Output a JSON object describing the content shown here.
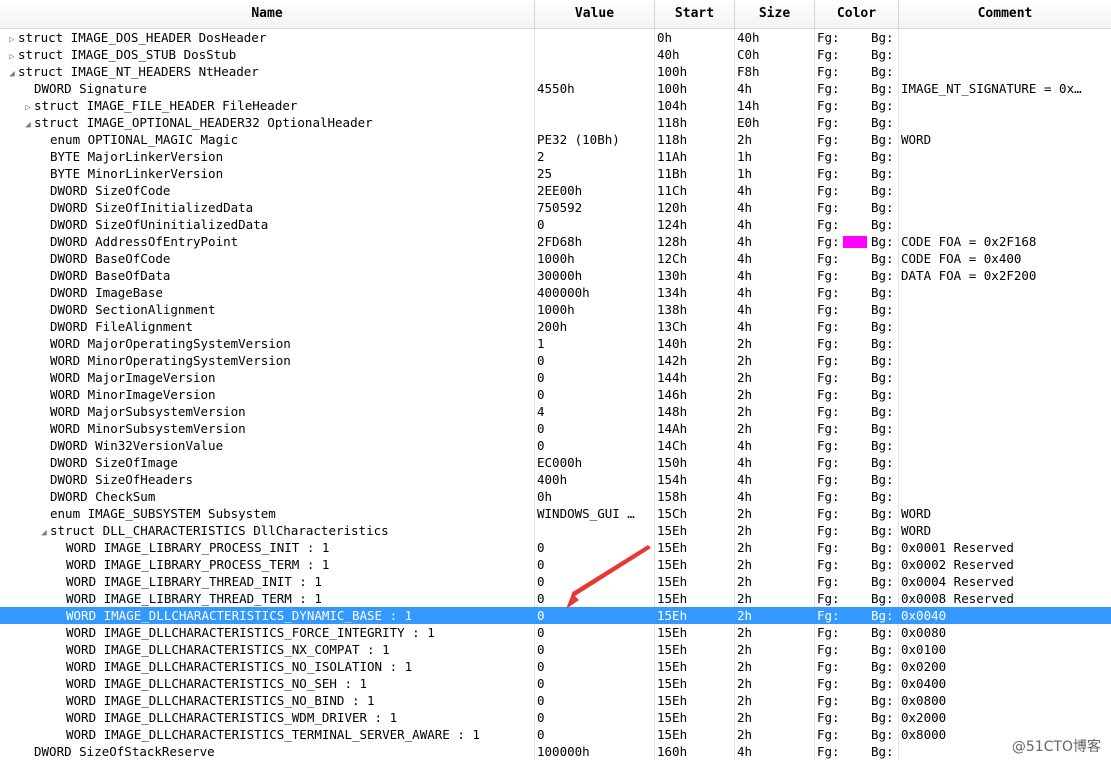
{
  "columns": [
    "Name",
    "Value",
    "Start",
    "Size",
    "Color",
    "Comment"
  ],
  "color_labels": {
    "fg": "Fg:",
    "bg": "Bg:"
  },
  "colors": {
    "selected_row": "#3399ff",
    "swatch_magenta": "#ff00ff",
    "arrow": "#e53935"
  },
  "rows": [
    {
      "indent": 0,
      "toggle": "▷",
      "name": "struct IMAGE_DOS_HEADER DosHeader",
      "value": "",
      "start": "0h",
      "size": "40h",
      "comment": ""
    },
    {
      "indent": 0,
      "toggle": "▷",
      "name": "struct IMAGE_DOS_STUB DosStub",
      "value": "",
      "start": "40h",
      "size": "C0h",
      "comment": ""
    },
    {
      "indent": 0,
      "toggle": "◢",
      "name": "struct IMAGE_NT_HEADERS NtHeader",
      "value": "",
      "start": "100h",
      "size": "F8h",
      "comment": ""
    },
    {
      "indent": 1,
      "toggle": "",
      "name": "DWORD Signature",
      "value": "4550h",
      "start": "100h",
      "size": "4h",
      "comment": "IMAGE_NT_SIGNATURE = 0x…"
    },
    {
      "indent": 1,
      "toggle": "▷",
      "name": "struct IMAGE_FILE_HEADER FileHeader",
      "value": "",
      "start": "104h",
      "size": "14h",
      "comment": ""
    },
    {
      "indent": 1,
      "toggle": "◢",
      "name": "struct IMAGE_OPTIONAL_HEADER32 OptionalHeader",
      "value": "",
      "start": "118h",
      "size": "E0h",
      "comment": ""
    },
    {
      "indent": 2,
      "toggle": "",
      "name": "enum OPTIONAL_MAGIC Magic",
      "value": "PE32 (10Bh)",
      "start": "118h",
      "size": "2h",
      "comment": "WORD"
    },
    {
      "indent": 2,
      "toggle": "",
      "name": "BYTE MajorLinkerVersion",
      "value": "2",
      "start": "11Ah",
      "size": "1h",
      "comment": ""
    },
    {
      "indent": 2,
      "toggle": "",
      "name": "BYTE MinorLinkerVersion",
      "value": "25",
      "start": "11Bh",
      "size": "1h",
      "comment": ""
    },
    {
      "indent": 2,
      "toggle": "",
      "name": "DWORD SizeOfCode",
      "value": "2EE00h",
      "start": "11Ch",
      "size": "4h",
      "comment": ""
    },
    {
      "indent": 2,
      "toggle": "",
      "name": "DWORD SizeOfInitializedData",
      "value": "750592",
      "start": "120h",
      "size": "4h",
      "comment": ""
    },
    {
      "indent": 2,
      "toggle": "",
      "name": "DWORD SizeOfUninitializedData",
      "value": "0",
      "start": "124h",
      "size": "4h",
      "comment": ""
    },
    {
      "indent": 2,
      "toggle": "",
      "name": "DWORD AddressOfEntryPoint",
      "value": "2FD68h",
      "start": "128h",
      "size": "4h",
      "comment": "CODE FOA = 0x2F168",
      "swatch": "#ff00ff"
    },
    {
      "indent": 2,
      "toggle": "",
      "name": "DWORD BaseOfCode",
      "value": "1000h",
      "start": "12Ch",
      "size": "4h",
      "comment": "CODE FOA = 0x400"
    },
    {
      "indent": 2,
      "toggle": "",
      "name": "DWORD BaseOfData",
      "value": "30000h",
      "start": "130h",
      "size": "4h",
      "comment": "DATA FOA = 0x2F200"
    },
    {
      "indent": 2,
      "toggle": "",
      "name": "DWORD ImageBase",
      "value": "400000h",
      "start": "134h",
      "size": "4h",
      "comment": ""
    },
    {
      "indent": 2,
      "toggle": "",
      "name": "DWORD SectionAlignment",
      "value": "1000h",
      "start": "138h",
      "size": "4h",
      "comment": ""
    },
    {
      "indent": 2,
      "toggle": "",
      "name": "DWORD FileAlignment",
      "value": "200h",
      "start": "13Ch",
      "size": "4h",
      "comment": ""
    },
    {
      "indent": 2,
      "toggle": "",
      "name": "WORD MajorOperatingSystemVersion",
      "value": "1",
      "start": "140h",
      "size": "2h",
      "comment": ""
    },
    {
      "indent": 2,
      "toggle": "",
      "name": "WORD MinorOperatingSystemVersion",
      "value": "0",
      "start": "142h",
      "size": "2h",
      "comment": ""
    },
    {
      "indent": 2,
      "toggle": "",
      "name": "WORD MajorImageVersion",
      "value": "0",
      "start": "144h",
      "size": "2h",
      "comment": ""
    },
    {
      "indent": 2,
      "toggle": "",
      "name": "WORD MinorImageVersion",
      "value": "0",
      "start": "146h",
      "size": "2h",
      "comment": ""
    },
    {
      "indent": 2,
      "toggle": "",
      "name": "WORD MajorSubsystemVersion",
      "value": "4",
      "start": "148h",
      "size": "2h",
      "comment": ""
    },
    {
      "indent": 2,
      "toggle": "",
      "name": "WORD MinorSubsystemVersion",
      "value": "0",
      "start": "14Ah",
      "size": "2h",
      "comment": ""
    },
    {
      "indent": 2,
      "toggle": "",
      "name": "DWORD Win32VersionValue",
      "value": "0",
      "start": "14Ch",
      "size": "4h",
      "comment": ""
    },
    {
      "indent": 2,
      "toggle": "",
      "name": "DWORD SizeOfImage",
      "value": "EC000h",
      "start": "150h",
      "size": "4h",
      "comment": ""
    },
    {
      "indent": 2,
      "toggle": "",
      "name": "DWORD SizeOfHeaders",
      "value": "400h",
      "start": "154h",
      "size": "4h",
      "comment": ""
    },
    {
      "indent": 2,
      "toggle": "",
      "name": "DWORD CheckSum",
      "value": "0h",
      "start": "158h",
      "size": "4h",
      "comment": ""
    },
    {
      "indent": 2,
      "toggle": "",
      "name": "enum IMAGE_SUBSYSTEM Subsystem",
      "value": "WINDOWS_GUI …",
      "start": "15Ch",
      "size": "2h",
      "comment": "WORD"
    },
    {
      "indent": 2,
      "toggle": "◢",
      "name": "struct DLL_CHARACTERISTICS DllCharacteristics",
      "value": "",
      "start": "15Eh",
      "size": "2h",
      "comment": "WORD"
    },
    {
      "indent": 3,
      "toggle": "",
      "name": "WORD IMAGE_LIBRARY_PROCESS_INIT : 1",
      "value": "0",
      "start": "15Eh",
      "size": "2h",
      "comment": "0x0001 Reserved"
    },
    {
      "indent": 3,
      "toggle": "",
      "name": "WORD IMAGE_LIBRARY_PROCESS_TERM : 1",
      "value": "0",
      "start": "15Eh",
      "size": "2h",
      "comment": "0x0002 Reserved"
    },
    {
      "indent": 3,
      "toggle": "",
      "name": "WORD IMAGE_LIBRARY_THREAD_INIT : 1",
      "value": "0",
      "start": "15Eh",
      "size": "2h",
      "comment": "0x0004 Reserved"
    },
    {
      "indent": 3,
      "toggle": "",
      "name": "WORD IMAGE_LIBRARY_THREAD_TERM : 1",
      "value": "0",
      "start": "15Eh",
      "size": "2h",
      "comment": "0x0008 Reserved"
    },
    {
      "indent": 3,
      "toggle": "",
      "name": "WORD IMAGE_DLLCHARACTERISTICS_DYNAMIC_BASE : 1",
      "value": "0",
      "start": "15Eh",
      "size": "2h",
      "comment": "0x0040",
      "selected": true
    },
    {
      "indent": 3,
      "toggle": "",
      "name": "WORD IMAGE_DLLCHARACTERISTICS_FORCE_INTEGRITY : 1",
      "value": "0",
      "start": "15Eh",
      "size": "2h",
      "comment": "0x0080"
    },
    {
      "indent": 3,
      "toggle": "",
      "name": "WORD IMAGE_DLLCHARACTERISTICS_NX_COMPAT : 1",
      "value": "0",
      "start": "15Eh",
      "size": "2h",
      "comment": "0x0100"
    },
    {
      "indent": 3,
      "toggle": "",
      "name": "WORD IMAGE_DLLCHARACTERISTICS_NO_ISOLATION : 1",
      "value": "0",
      "start": "15Eh",
      "size": "2h",
      "comment": "0x0200"
    },
    {
      "indent": 3,
      "toggle": "",
      "name": "WORD IMAGE_DLLCHARACTERISTICS_NO_SEH : 1",
      "value": "0",
      "start": "15Eh",
      "size": "2h",
      "comment": "0x0400"
    },
    {
      "indent": 3,
      "toggle": "",
      "name": "WORD IMAGE_DLLCHARACTERISTICS_NO_BIND : 1",
      "value": "0",
      "start": "15Eh",
      "size": "2h",
      "comment": "0x0800"
    },
    {
      "indent": 3,
      "toggle": "",
      "name": "WORD IMAGE_DLLCHARACTERISTICS_WDM_DRIVER : 1",
      "value": "0",
      "start": "15Eh",
      "size": "2h",
      "comment": "0x2000"
    },
    {
      "indent": 3,
      "toggle": "",
      "name": "WORD IMAGE_DLLCHARACTERISTICS_TERMINAL_SERVER_AWARE : 1",
      "value": "0",
      "start": "15Eh",
      "size": "2h",
      "comment": "0x8000"
    },
    {
      "indent": 1,
      "toggle": "",
      "name": "DWORD SizeOfStackReserve",
      "value": "100000h",
      "start": "160h",
      "size": "4h",
      "comment": ""
    }
  ],
  "watermark": "@51CTO博客"
}
